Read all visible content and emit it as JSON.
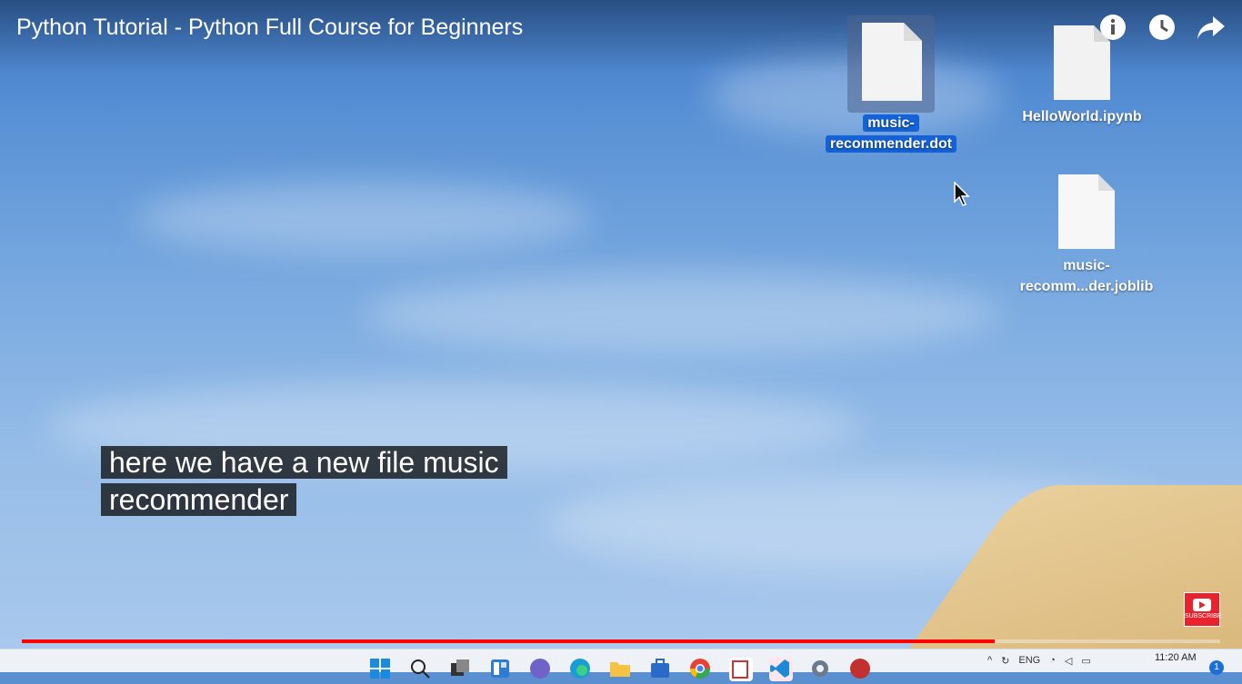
{
  "video": {
    "title": "Python Tutorial - Python Full Course for Beginners",
    "caption_line1": "here we have a new file music",
    "caption_line2": "recommender",
    "subscribe_label": "SUBSCRIBE",
    "progress": 0.812
  },
  "top_icons": [
    "info-icon",
    "watch-later-icon",
    "share-icon"
  ],
  "desktop_files": [
    {
      "line1": "music-",
      "line2": "recommender.dot",
      "selected": true
    },
    {
      "line1": "HelloWorld.ipynb",
      "line2": ""
    },
    {
      "line1": "music-",
      "line2": "recomm...der.joblib"
    }
  ],
  "taskbar": {
    "apps": [
      "windows-start-icon",
      "search-icon",
      "task-view-icon",
      "widgets-icon",
      "teams-icon",
      "edge-icon",
      "file-explorer-icon",
      "store-icon",
      "chrome-icon",
      "app-icon",
      "vscode-icon",
      "settings-icon",
      "app-red-icon"
    ],
    "language": "ENG",
    "time": "11:20 AM",
    "notification_count": "1"
  },
  "colors": {
    "progress": "#ff0000",
    "selection": "#1462d6",
    "subscribe": "#e8232e"
  }
}
